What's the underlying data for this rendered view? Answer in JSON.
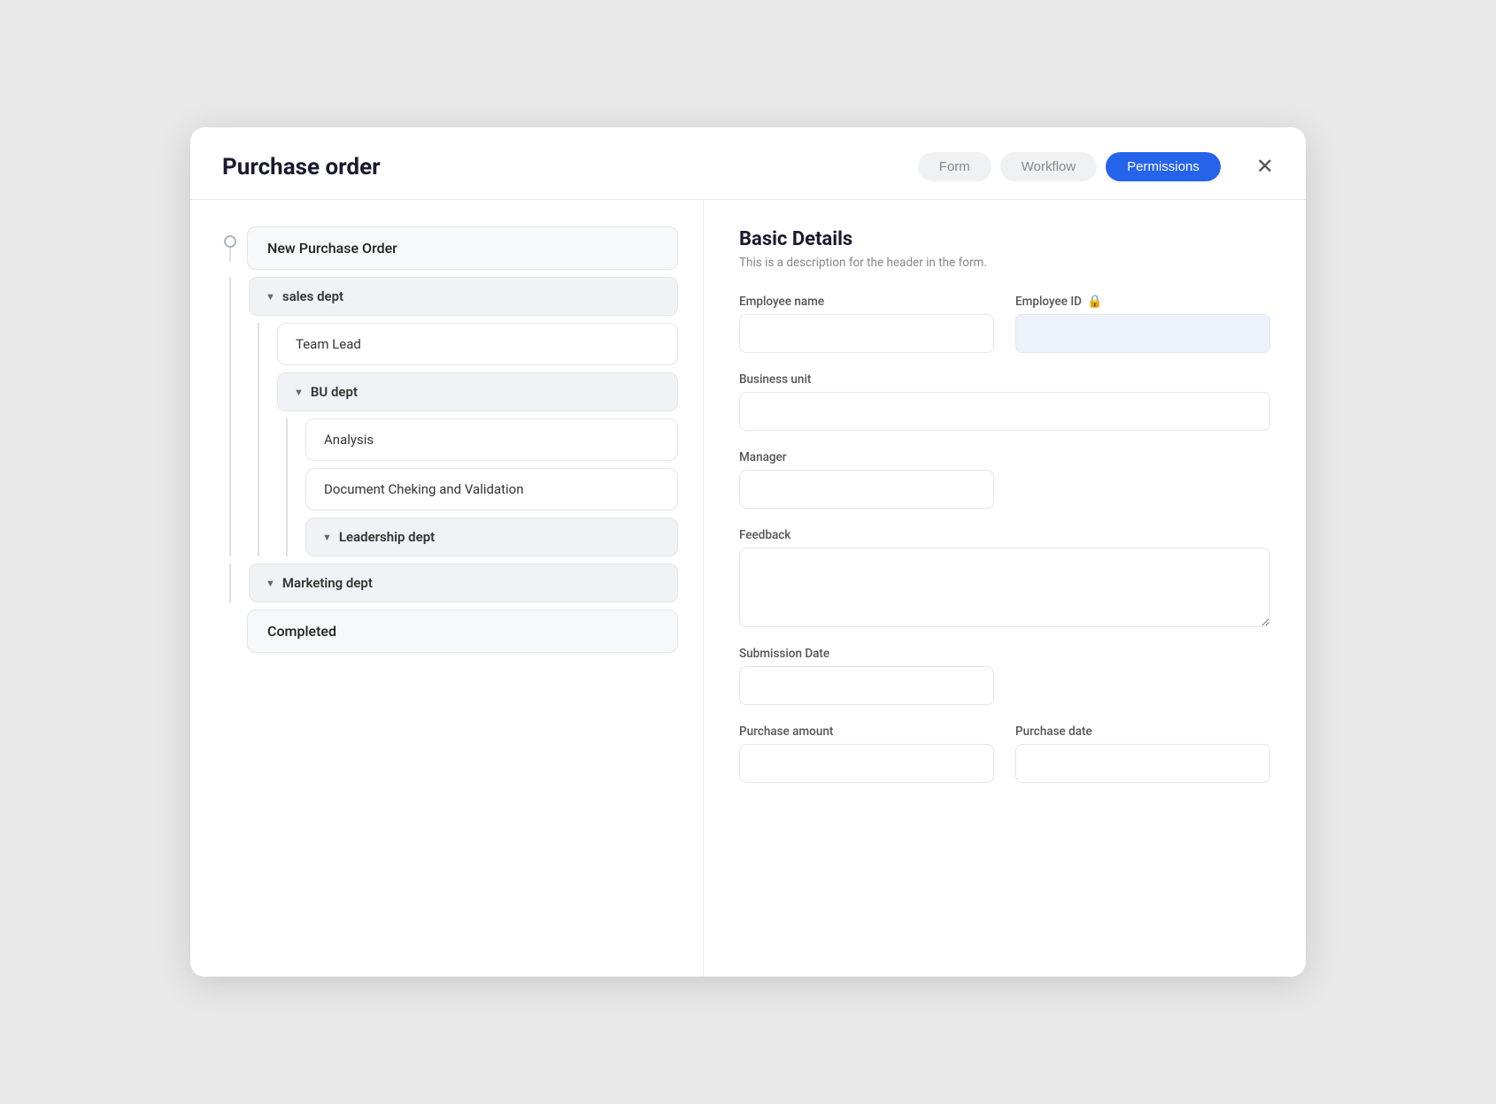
{
  "modal": {
    "title": "Purchase order",
    "close_label": "✕"
  },
  "tabs": [
    {
      "id": "form",
      "label": "Form",
      "active": false
    },
    {
      "id": "workflow",
      "label": "Workflow",
      "active": false
    },
    {
      "id": "permissions",
      "label": "Permissions",
      "active": true
    }
  ],
  "workflow": {
    "root": "New Purchase Order",
    "groups": [
      {
        "id": "sales-dept",
        "label": "sales dept",
        "children": [
          {
            "id": "team-lead",
            "label": "Team Lead",
            "type": "leaf"
          },
          {
            "id": "bu-dept",
            "label": "BU dept",
            "type": "group",
            "children": [
              {
                "id": "analysis",
                "label": "Analysis",
                "type": "leaf"
              },
              {
                "id": "doc-checking",
                "label": "Document Cheking and Validation",
                "type": "leaf"
              },
              {
                "id": "leadership-dept",
                "label": "Leadership dept",
                "type": "group",
                "children": []
              }
            ]
          }
        ]
      },
      {
        "id": "marketing-dept",
        "label": "Marketing dept",
        "children": []
      }
    ],
    "completed": "Completed"
  },
  "form": {
    "title": "Basic Details",
    "description": "This is a description for the header in the form.",
    "fields": [
      {
        "id": "employee-name",
        "label": "Employee name",
        "placeholder": "",
        "locked": false,
        "type": "text",
        "half": true
      },
      {
        "id": "employee-id",
        "label": "Employee ID",
        "placeholder": "",
        "locked": true,
        "type": "text",
        "half": true,
        "disabled": true
      },
      {
        "id": "business-unit",
        "label": "Business unit",
        "placeholder": "",
        "locked": false,
        "type": "text",
        "half": false
      },
      {
        "id": "manager",
        "label": "Manager",
        "placeholder": "",
        "locked": false,
        "type": "text",
        "half": true
      },
      {
        "id": "feedback",
        "label": "Feedback",
        "placeholder": "",
        "locked": false,
        "type": "textarea",
        "half": false
      },
      {
        "id": "submission-date",
        "label": "Submission Date",
        "placeholder": "",
        "locked": false,
        "type": "text",
        "half": true
      },
      {
        "id": "purchase-amount",
        "label": "Purchase amount",
        "placeholder": "",
        "locked": false,
        "type": "text",
        "half": true
      },
      {
        "id": "purchase-date",
        "label": "Purchase date",
        "placeholder": "",
        "locked": false,
        "type": "text",
        "half": true
      }
    ]
  }
}
